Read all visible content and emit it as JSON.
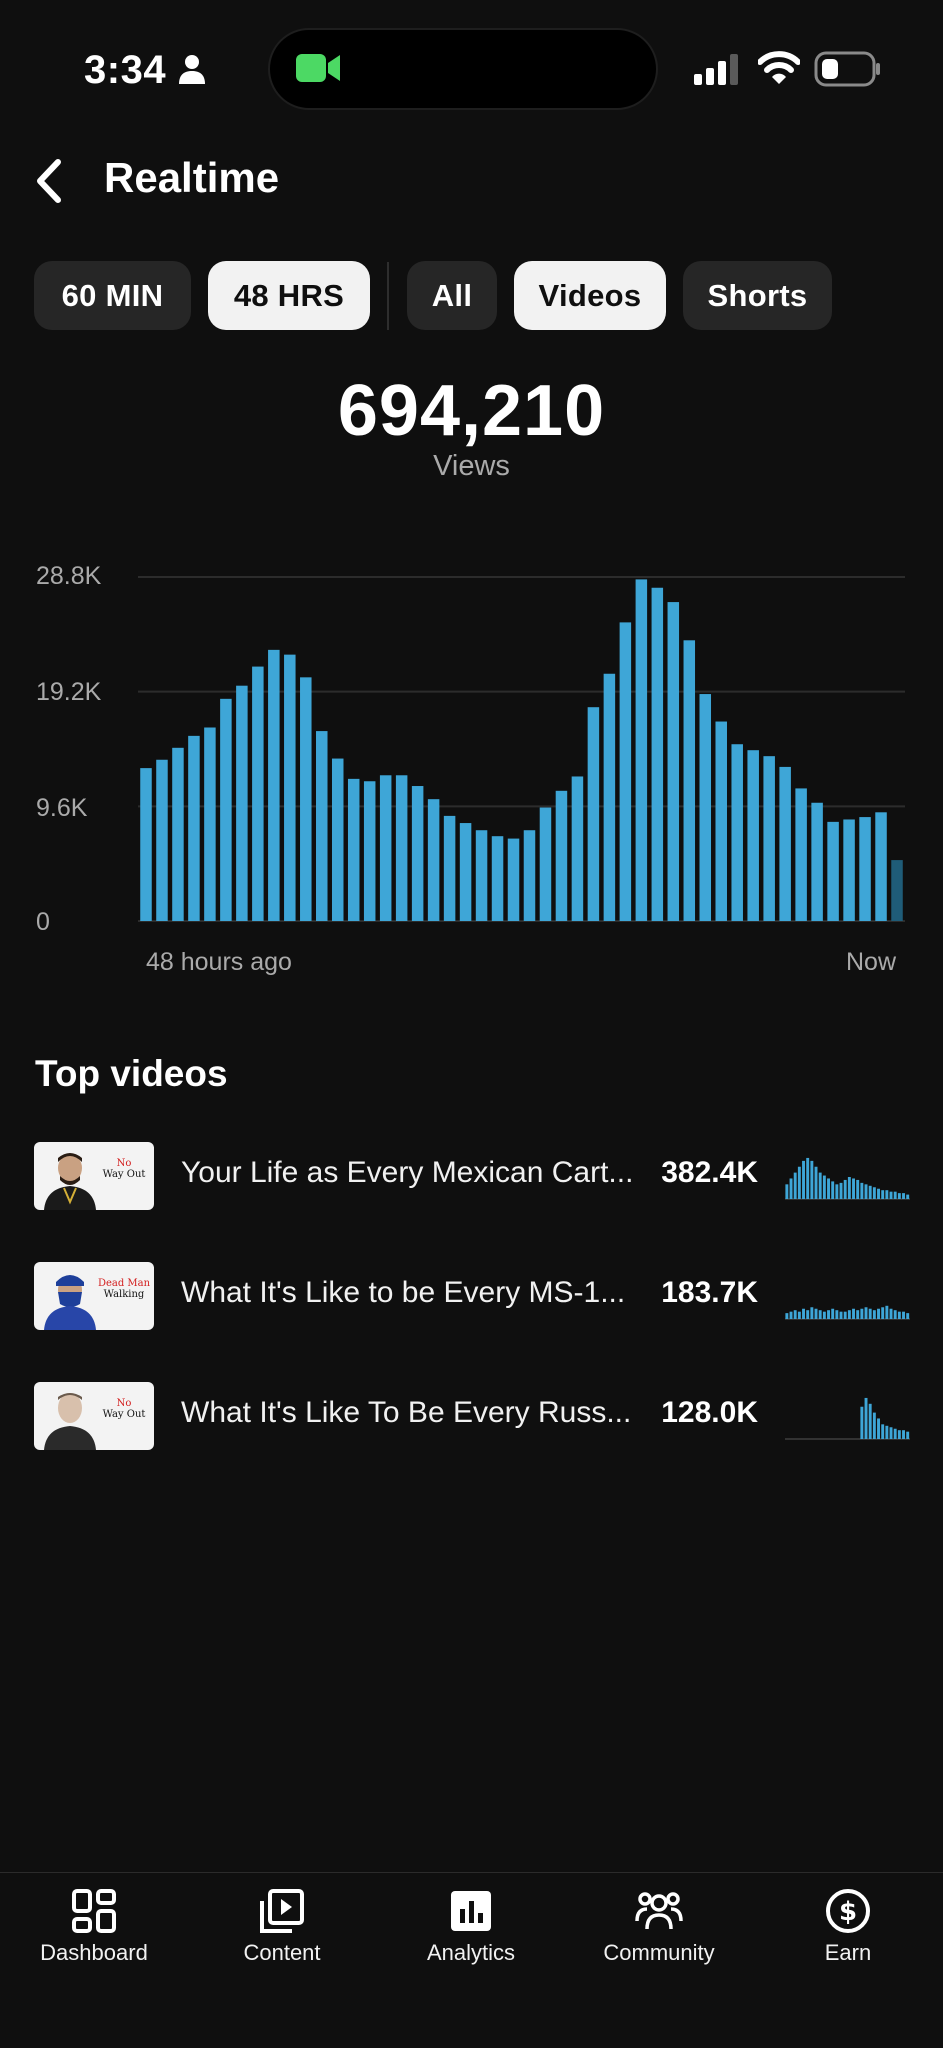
{
  "status_bar": {
    "time": "3:34"
  },
  "header": {
    "title": "Realtime"
  },
  "filters": {
    "time_range": [
      {
        "label": "60 MIN",
        "active": false
      },
      {
        "label": "48 HRS",
        "active": true
      }
    ],
    "content_type": [
      {
        "label": "All",
        "active": false
      },
      {
        "label": "Videos",
        "active": true
      },
      {
        "label": "Shorts",
        "active": false
      }
    ]
  },
  "summary": {
    "value": "694,210",
    "label": "Views"
  },
  "chart_data": {
    "type": "bar",
    "x_start_label": "48 hours ago",
    "x_end_label": "Now",
    "y_ticks": [
      "28.8K",
      "19.2K",
      "9.6K",
      "0"
    ],
    "ylim": [
      0,
      28800
    ],
    "grid": true,
    "color": "#3ea6d7",
    "values": [
      12800,
      13500,
      14500,
      15500,
      16200,
      18600,
      19700,
      21300,
      22700,
      22300,
      20400,
      15900,
      13600,
      11900,
      11700,
      12200,
      12200,
      11300,
      10200,
      8800,
      8200,
      7600,
      7100,
      6900,
      7600,
      9500,
      10900,
      12100,
      17900,
      20700,
      25000,
      28600,
      27900,
      26700,
      23500,
      19000,
      16700,
      14800,
      14300,
      13800,
      12900,
      11100,
      9900,
      8300,
      8500,
      8700,
      9100,
      5100
    ],
    "last_bar_partial": true
  },
  "top_videos": {
    "title": "Top videos",
    "items": [
      {
        "title": "Your Life as Every Mexican Cart...",
        "views": "382.4K",
        "thumb_top": "No",
        "thumb_bottom": "Way Out",
        "spark": [
          10,
          14,
          18,
          22,
          26,
          28,
          26,
          22,
          18,
          16,
          14,
          12,
          10,
          11,
          13,
          15,
          14,
          13,
          11,
          10,
          9,
          8,
          7,
          6,
          6,
          5,
          5,
          4,
          4,
          3
        ]
      },
      {
        "title": "What It's Like to be Every MS-1...",
        "views": "183.7K",
        "thumb_top": "Dead Man",
        "thumb_bottom": "Walking",
        "spark": [
          4,
          5,
          6,
          5,
          7,
          6,
          8,
          7,
          6,
          5,
          6,
          7,
          6,
          5,
          5,
          6,
          7,
          6,
          7,
          8,
          7,
          6,
          7,
          8,
          9,
          7,
          6,
          5,
          5,
          4
        ]
      },
      {
        "title": "What It's Like To Be Every Russ...",
        "views": "128.0K",
        "thumb_top": "No",
        "thumb_bottom": "Way Out",
        "spark": [
          0,
          0,
          0,
          0,
          0,
          0,
          0,
          0,
          0,
          0,
          0,
          0,
          0,
          0,
          0,
          0,
          0,
          0,
          22,
          28,
          24,
          18,
          14,
          10,
          9,
          8,
          7,
          6,
          6,
          5
        ]
      }
    ]
  },
  "bottom_nav": {
    "items": [
      {
        "label": "Dashboard",
        "icon": "dashboard-icon"
      },
      {
        "label": "Content",
        "icon": "content-icon"
      },
      {
        "label": "Analytics",
        "icon": "analytics-icon",
        "active": true
      },
      {
        "label": "Community",
        "icon": "community-icon"
      },
      {
        "label": "Earn",
        "icon": "earn-icon"
      }
    ]
  }
}
